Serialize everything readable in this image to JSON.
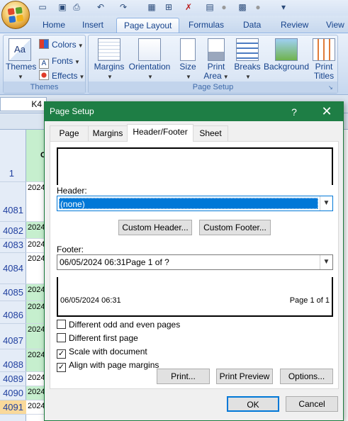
{
  "qat": {
    "icons": [
      "new-icon",
      "save-icon",
      "print-preview-icon",
      "undo-icon",
      "redo-icon"
    ]
  },
  "ribbon_tabs": [
    "Home",
    "Insert",
    "Page Layout",
    "Formulas",
    "Data",
    "Review",
    "View"
  ],
  "ribbon": {
    "themes_group": {
      "label": "Themes",
      "themes": "Themes",
      "colors": "Colors",
      "fonts": "Fonts",
      "effects": "Effects"
    },
    "page_setup_group": {
      "label": "Page Setup",
      "margins": "Margins",
      "orientation": "Orientation",
      "size": "Size",
      "print_area_1": "Print",
      "print_area_2": "Area",
      "breaks": "Breaks",
      "background": "Background",
      "print_titles_1": "Print",
      "print_titles_2": "Titles"
    }
  },
  "namebox": "K4",
  "column_header_row": "1",
  "rows": [
    "4081",
    "4082",
    "4083",
    "4084",
    "4085",
    "4086",
    "4087",
    "4088",
    "4089",
    "4090",
    "4091"
  ],
  "cell_prefix": "2024",
  "header_text_fragment": "C",
  "dialog": {
    "title": "Page Setup",
    "help": "?",
    "tabs": [
      "Page",
      "Margins",
      "Header/Footer",
      "Sheet"
    ],
    "header_label": "Header:",
    "header_value": "(none)",
    "custom_header": "Custom Header...",
    "custom_footer": "Custom Footer...",
    "footer_label": "Footer:",
    "footer_value": "06/05/2024 06:31Page 1 of ?",
    "footer_preview_left": "06/05/2024 06:31",
    "footer_preview_right": "Page 1 of 1",
    "checks": [
      {
        "label": "Different odd and even pages",
        "checked": false
      },
      {
        "label": "Different first page",
        "checked": false
      },
      {
        "label": "Scale with document",
        "checked": true
      },
      {
        "label": "Align with page margins",
        "checked": true
      }
    ],
    "print": "Print...",
    "print_preview": "Print Preview",
    "options": "Options...",
    "ok": "OK",
    "cancel": "Cancel"
  }
}
